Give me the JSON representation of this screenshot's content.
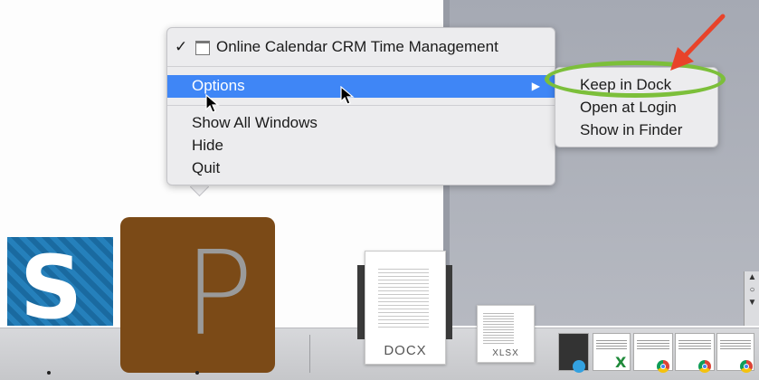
{
  "context_menu": {
    "window_check": "✓",
    "window_title": "Online Calendar CRM Time Management",
    "options_label": "Options",
    "options_arrow": "▶",
    "show_all_windows": "Show All Windows",
    "hide": "Hide",
    "quit": "Quit"
  },
  "options_submenu": {
    "keep_in_dock": "Keep in Dock",
    "open_at_login": "Open at Login",
    "show_in_finder": "Show in Finder"
  },
  "dock": {
    "app_s_glyph": "S",
    "app_p_glyph": "P",
    "docx_label": "DOCX",
    "xlsx_label": "XLSX",
    "minimized_x_glyph": "X"
  },
  "scroll_controls": {
    "up": "▲",
    "search": "○",
    "down": "▼"
  },
  "colors": {
    "menu_highlight": "#3f86f6",
    "annotation_ring": "#7cbf3a",
    "annotation_arrow": "#e8432a",
    "app_p_bg": "#7b4a17",
    "app_s_bg": "#1d6ea5"
  }
}
